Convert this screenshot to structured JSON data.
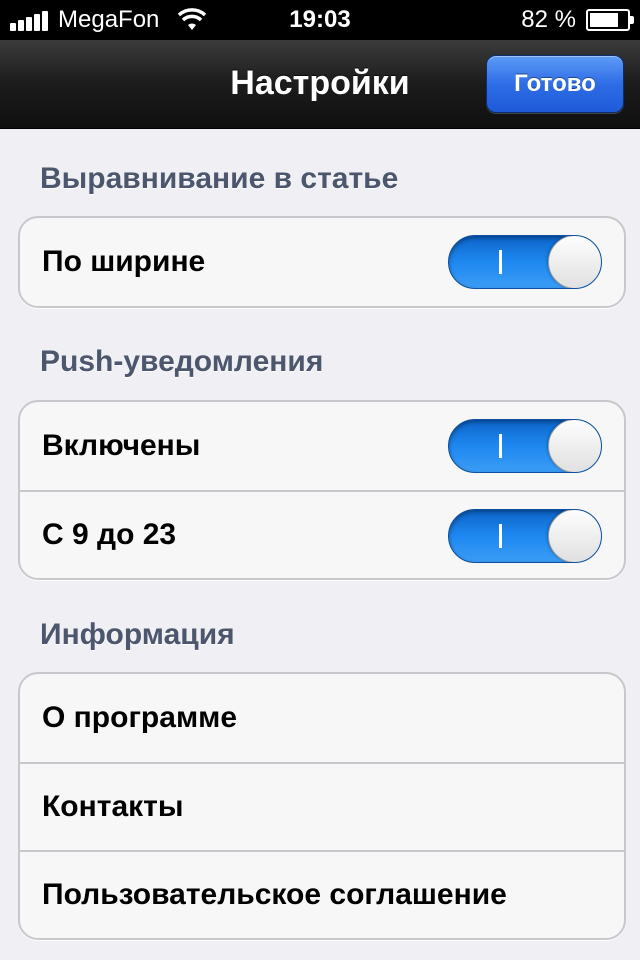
{
  "status_bar": {
    "carrier": "MegaFon",
    "time": "19:03",
    "battery": "82 %",
    "icons": [
      "signal-icon",
      "wifi-icon",
      "battery-icon"
    ]
  },
  "nav": {
    "title": "Настройки",
    "done_label": "Готово"
  },
  "sections": [
    {
      "header": "Выравнивание в статье",
      "rows": [
        {
          "label": "По ширине",
          "toggle": true
        }
      ]
    },
    {
      "header": "Push-уведомления",
      "rows": [
        {
          "label": "Включены",
          "toggle": true
        },
        {
          "label": "С 9 до 23",
          "toggle": true
        }
      ]
    },
    {
      "header": "Информация",
      "rows": [
        {
          "label": "О программе"
        },
        {
          "label": "Контакты"
        },
        {
          "label": "Пользовательское соглашение"
        }
      ]
    }
  ],
  "colors": {
    "accent": "#1e88f0",
    "section_header": "#4c566c",
    "background": "#efeff4"
  }
}
